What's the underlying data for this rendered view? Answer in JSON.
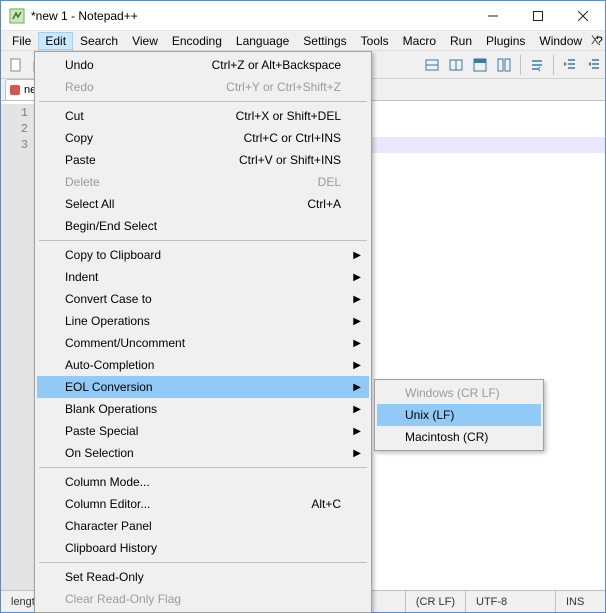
{
  "title": "*new 1 - Notepad++",
  "menubar": [
    "File",
    "Edit",
    "Search",
    "View",
    "Encoding",
    "Language",
    "Settings",
    "Tools",
    "Macro",
    "Run",
    "Plugins",
    "Window",
    "?"
  ],
  "menubar_open_index": 1,
  "tab": {
    "label": "ne"
  },
  "gutter_lines": [
    "1",
    "2",
    "3"
  ],
  "edit_menu": [
    {
      "label": "Undo",
      "shortcut": "Ctrl+Z or Alt+Backspace"
    },
    {
      "label": "Redo",
      "shortcut": "Ctrl+Y or Ctrl+Shift+Z",
      "disabled": true
    },
    {
      "sep": true
    },
    {
      "label": "Cut",
      "shortcut": "Ctrl+X or Shift+DEL"
    },
    {
      "label": "Copy",
      "shortcut": "Ctrl+C or Ctrl+INS"
    },
    {
      "label": "Paste",
      "shortcut": "Ctrl+V or Shift+INS"
    },
    {
      "label": "Delete",
      "shortcut": "DEL",
      "disabled": true
    },
    {
      "label": "Select All",
      "shortcut": "Ctrl+A"
    },
    {
      "label": "Begin/End Select"
    },
    {
      "sep": true
    },
    {
      "label": "Copy to Clipboard",
      "submenu": true
    },
    {
      "label": "Indent",
      "submenu": true
    },
    {
      "label": "Convert Case to",
      "submenu": true
    },
    {
      "label": "Line Operations",
      "submenu": true
    },
    {
      "label": "Comment/Uncomment",
      "submenu": true
    },
    {
      "label": "Auto-Completion",
      "submenu": true
    },
    {
      "label": "EOL Conversion",
      "submenu": true,
      "highlight": true
    },
    {
      "label": "Blank Operations",
      "submenu": true
    },
    {
      "label": "Paste Special",
      "submenu": true
    },
    {
      "label": "On Selection",
      "submenu": true
    },
    {
      "sep": true
    },
    {
      "label": "Column Mode..."
    },
    {
      "label": "Column Editor...",
      "shortcut": "Alt+C"
    },
    {
      "label": "Character Panel"
    },
    {
      "label": "Clipboard History"
    },
    {
      "sep": true
    },
    {
      "label": "Set Read-Only"
    },
    {
      "label": "Clear Read-Only Flag",
      "disabled": true
    }
  ],
  "eol_submenu": [
    {
      "label": "Windows (CR LF)",
      "disabled": true
    },
    {
      "label": "Unix (LF)",
      "highlight": true
    },
    {
      "label": "Macintosh (CR)"
    }
  ],
  "status": {
    "length": "length",
    "eol": "(CR LF)",
    "encoding": "UTF-8",
    "ins": "INS"
  }
}
